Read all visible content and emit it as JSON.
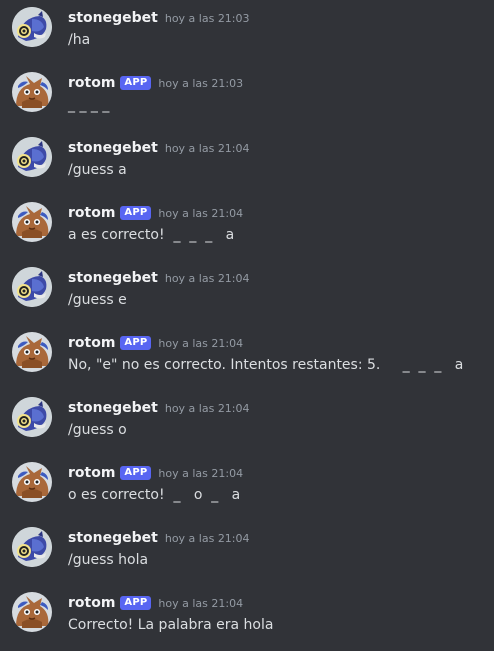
{
  "messages": [
    {
      "username": "stonegebet",
      "app": false,
      "timestamp": "hoy a las 21:03",
      "content": "/ha"
    },
    {
      "username": "rotom",
      "app": true,
      "badge": "APP",
      "timestamp": "hoy a las 21:03",
      "content": "_ _ _ _"
    },
    {
      "username": "stonegebet",
      "app": false,
      "timestamp": "hoy a las 21:04",
      "content": "/guess a"
    },
    {
      "username": "rotom",
      "app": true,
      "badge": "APP",
      "timestamp": "hoy a las 21:04",
      "content": "a es correcto!  _  _  _   a"
    },
    {
      "username": "stonegebet",
      "app": false,
      "timestamp": "hoy a las 21:04",
      "content": "/guess e"
    },
    {
      "username": "rotom",
      "app": true,
      "badge": "APP",
      "timestamp": "hoy a las 21:04",
      "content": "No, \"e\" no es correcto. Intentos restantes: 5.     _  _  _   a"
    },
    {
      "username": "stonegebet",
      "app": false,
      "timestamp": "hoy a las 21:04",
      "content": "/guess o"
    },
    {
      "username": "rotom",
      "app": true,
      "badge": "APP",
      "timestamp": "hoy a las 21:04",
      "content": "o es correcto!  _   o  _   a"
    },
    {
      "username": "stonegebet",
      "app": false,
      "timestamp": "hoy a las 21:04",
      "content": "/guess hola"
    },
    {
      "username": "rotom",
      "app": true,
      "badge": "APP",
      "timestamp": "hoy a las 21:04",
      "content": "Correcto! La palabra era hola"
    }
  ],
  "colors": {
    "background": "#313338",
    "username": "#f2f3f5",
    "content": "#dbdee1",
    "timestamp": "#949ba4",
    "app_badge": "#5865f2"
  },
  "icons": {
    "stonegebet_avatar": "stonegebet-avatar-icon",
    "rotom_avatar": "rotom-avatar-icon"
  }
}
